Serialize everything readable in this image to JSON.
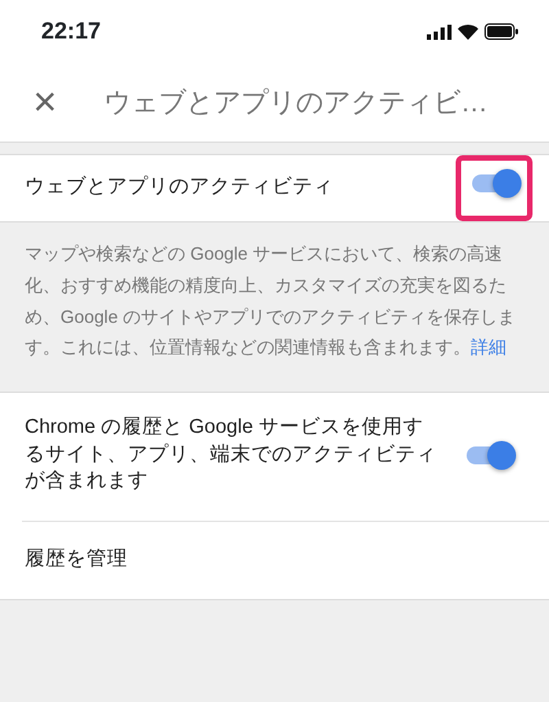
{
  "status_bar": {
    "time": "22:17"
  },
  "header": {
    "close": "×",
    "title": "ウェブとアプリのアクティビ…"
  },
  "main_setting": {
    "label": "ウェブとアプリのアクティビティ",
    "on": true,
    "highlighted": true
  },
  "description": {
    "text": "マップや検索などの Google サービスにおいて、検索の高速化、おすすめ機能の精度向上、カスタマイズの充実を図るため、Google のサイトやアプリでのアクティビティを保存します。これには、位置情報などの関連情報も含まれます。",
    "link": "詳細"
  },
  "sub_settings": [
    {
      "kind": "toggle",
      "label": "Chrome の履歴と Google サービスを使用するサイト、アプリ、端末でのアクティビティが含まれます",
      "on": true
    },
    {
      "kind": "link",
      "label": "履歴を管理"
    }
  ]
}
